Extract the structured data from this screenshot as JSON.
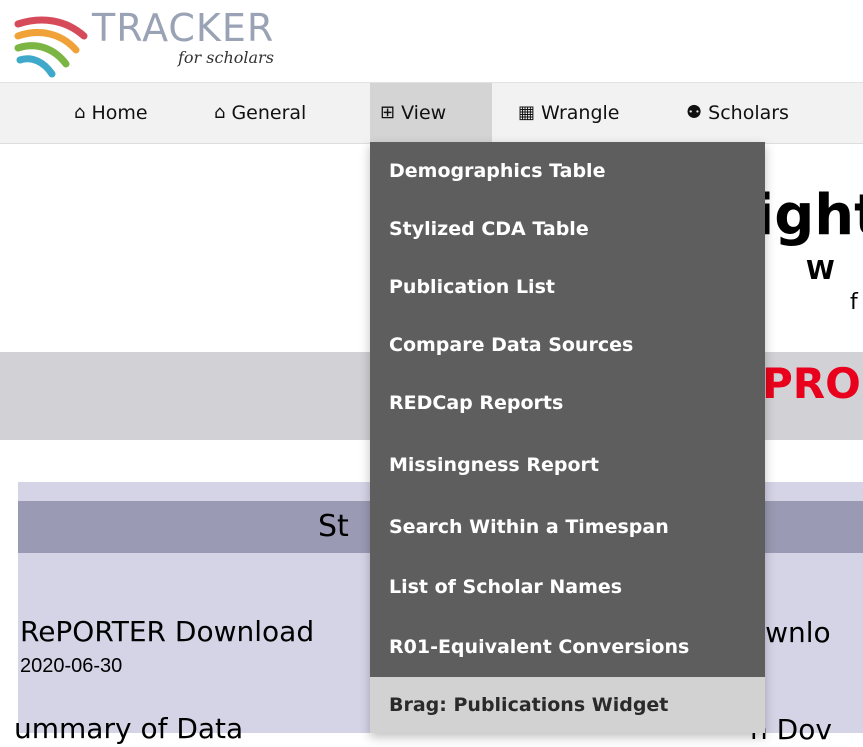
{
  "logo": {
    "word": "TRACKER",
    "sub": "for scholars"
  },
  "nav": {
    "items": [
      {
        "icon": "home-icon",
        "glyph": "⌂",
        "label": "Home"
      },
      {
        "icon": "general-home-icon",
        "glyph": "⌂",
        "label": "General"
      },
      {
        "icon": "table-icon",
        "glyph": "⊞",
        "label": "View"
      },
      {
        "icon": "calculator-icon",
        "glyph": "▦",
        "label": "Wrangle"
      },
      {
        "icon": "people-icon",
        "glyph": "⚉",
        "label": "Scholars"
      }
    ],
    "active_index": 2
  },
  "menu": {
    "items": [
      "Demographics Table",
      "Stylized CDA Table",
      "Publication List",
      "Compare Data Sources",
      "REDCap Reports",
      "Missingness Report",
      "Search Within a Timespan",
      "List of Scholar Names",
      "R01-Equivalent Conversions",
      "Brag: Publications Widget"
    ],
    "highlighted_index": 9
  },
  "background": {
    "title_fragment": "ight",
    "sub1_fragment": "W",
    "sub2_fragment": "f",
    "banner_fragment": "PRO",
    "panel_title_fragment": "St",
    "reporter_title": "RePORTER Download",
    "reporter_date": "2020-06-30",
    "summary_title": "ummary of Data",
    "right_fragment_a": "ownlo",
    "right_fragment_b": "h Dov"
  },
  "colors": {
    "menu_bg": "#5e5e5e",
    "menu_highlight": "#d2d2d2",
    "banner_text": "#e8001c",
    "panel_bg": "#d4d4e6",
    "panel_header": "#9a9ab4"
  }
}
